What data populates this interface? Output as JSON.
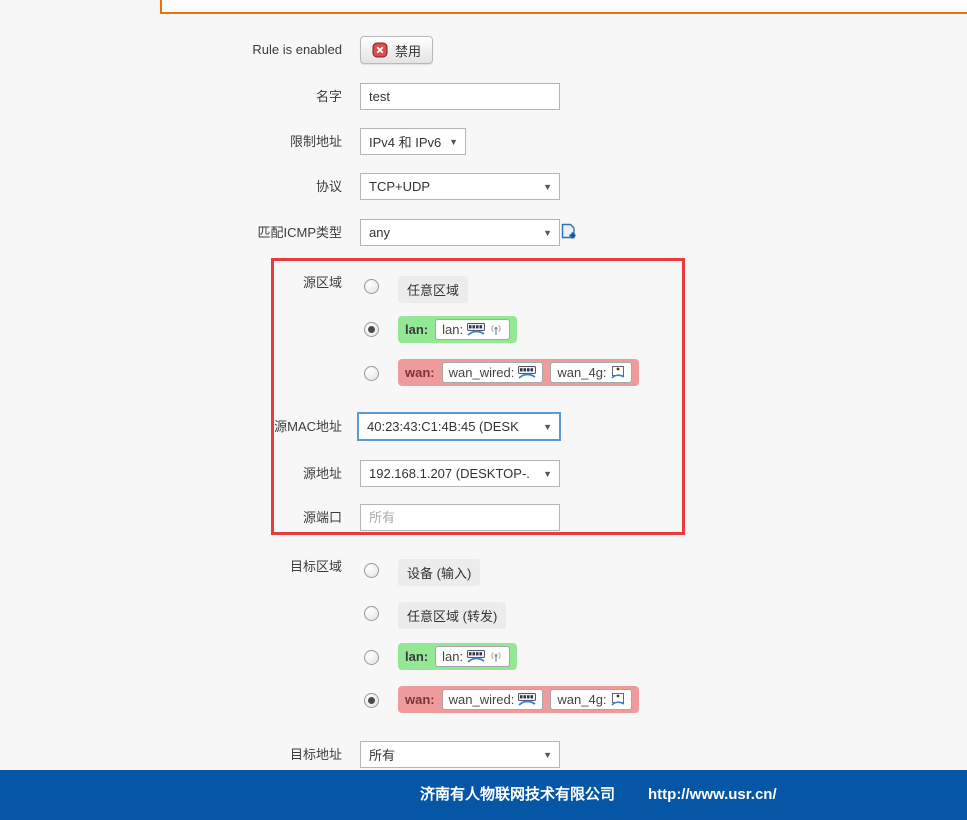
{
  "page": {
    "background_color": "#f7f7f7"
  },
  "panel": {
    "border_color": "#e8730a"
  },
  "annotation": {
    "highlight_color": "#e93b3b"
  },
  "zones": {
    "lan": {
      "name": "lan:",
      "color": "#94e794",
      "networks": [
        {
          "label": "lan:",
          "icons": [
            "ethernet-icon",
            "wifi-icon"
          ]
        }
      ]
    },
    "wan": {
      "name": "wan:",
      "color": "#f09b9b",
      "networks": [
        {
          "label": "wan_wired:",
          "icons": [
            "ethernet-icon"
          ]
        },
        {
          "label": "wan_4g:",
          "icons": [
            "modem-icon"
          ]
        }
      ]
    }
  },
  "form": {
    "rule_enabled": {
      "label": "Rule is enabled",
      "button_label": "禁用"
    },
    "name": {
      "label": "名字",
      "value": "test"
    },
    "restrict_address": {
      "label": "限制地址",
      "value": "IPv4 和 IPv6"
    },
    "protocol": {
      "label": "协议",
      "value": "TCP+UDP"
    },
    "icmp_type": {
      "label": "匹配ICMP类型",
      "value": "any"
    },
    "source_zone": {
      "label": "源区域",
      "any_label": "任意区域",
      "selected": "lan"
    },
    "source_mac": {
      "label": "源MAC地址",
      "value": "40:23:43:C1:4B:45 (DESK"
    },
    "source_address": {
      "label": "源地址",
      "value": "192.168.1.207 (DESKTOP-."
    },
    "source_port": {
      "label": "源端口",
      "placeholder": "所有"
    },
    "dest_zone": {
      "label": "目标区域",
      "device_label": "设备 (输入)",
      "any_label": "任意区域 (转发)",
      "selected": "wan"
    },
    "dest_address": {
      "label": "目标地址",
      "value": "所有"
    }
  },
  "footer": {
    "company": "济南有人物联网技术有限公司",
    "url": "http://www.usr.cn/",
    "background_color": "#0556a5"
  }
}
